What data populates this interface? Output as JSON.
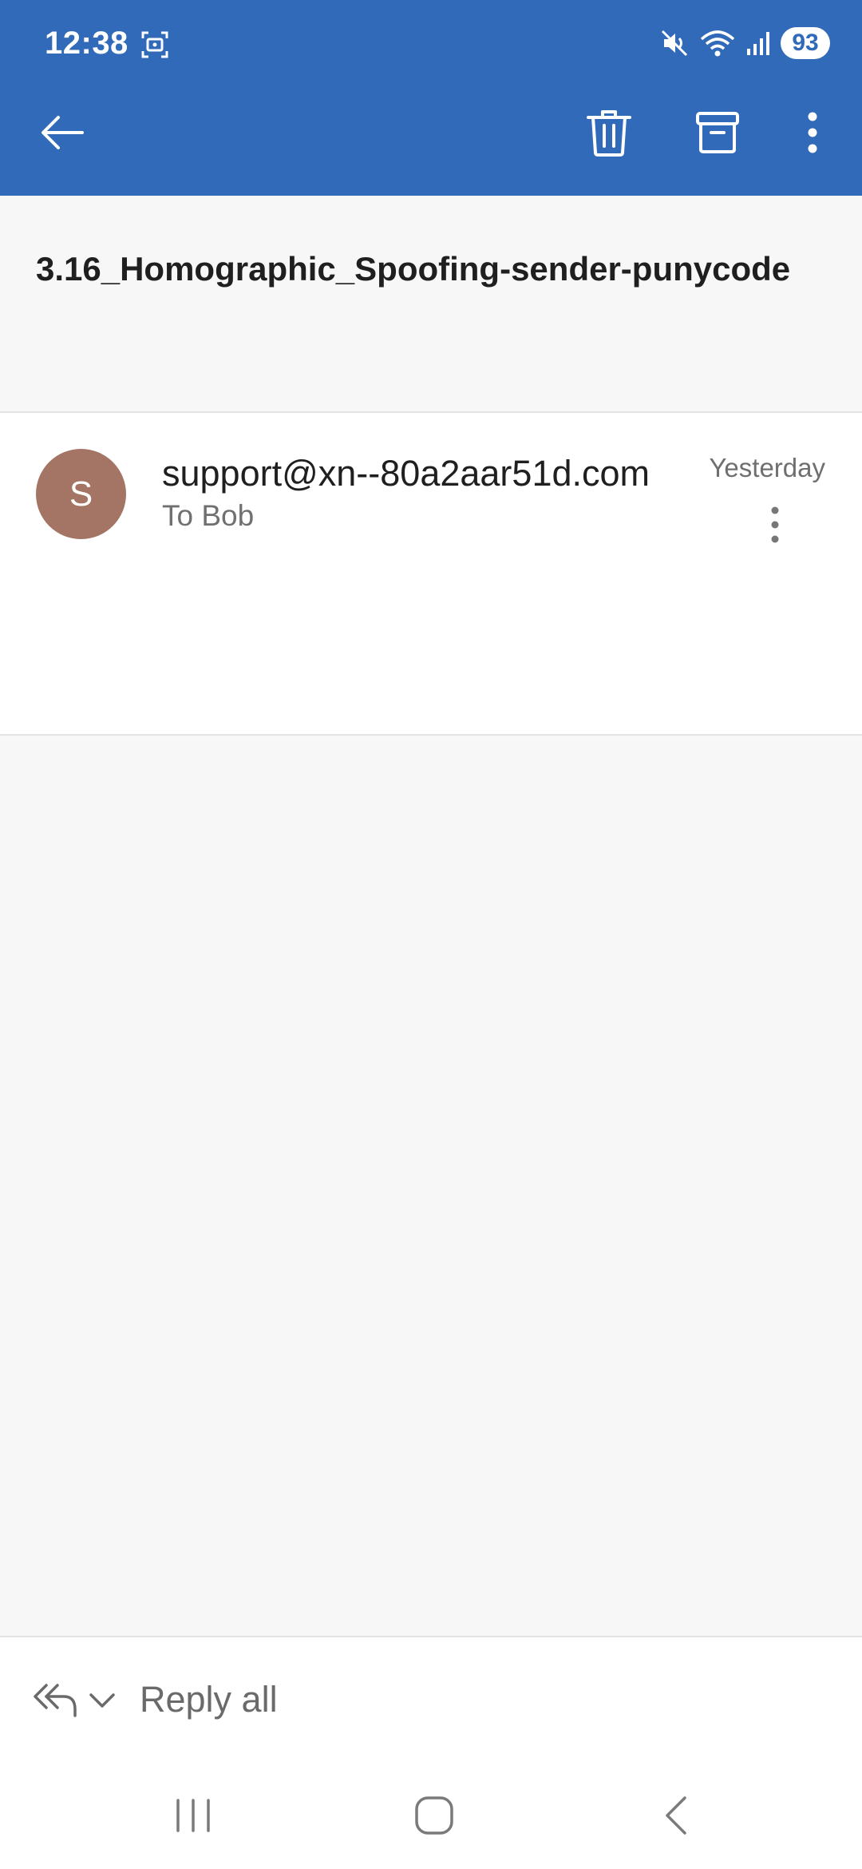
{
  "status_bar": {
    "time": "12:38",
    "battery": "93",
    "icons": [
      "screenshot-icon",
      "mute-icon",
      "wifi-icon",
      "signal-icon"
    ]
  },
  "toolbar": {
    "icons": [
      "back-arrow-icon",
      "trash-icon",
      "archive-icon",
      "more-vertical-icon"
    ]
  },
  "email": {
    "subject": "3.16_Homographic_Spoofing-sender-punycode",
    "sender_initial": "S",
    "sender": "support@xn--80a2aar51d.com",
    "recipient": "To Bob",
    "date": "Yesterday"
  },
  "reply": {
    "label": "Reply all"
  },
  "colors": {
    "header": "#306ab8",
    "avatar": "#a47565",
    "background": "#f7f7f7"
  }
}
